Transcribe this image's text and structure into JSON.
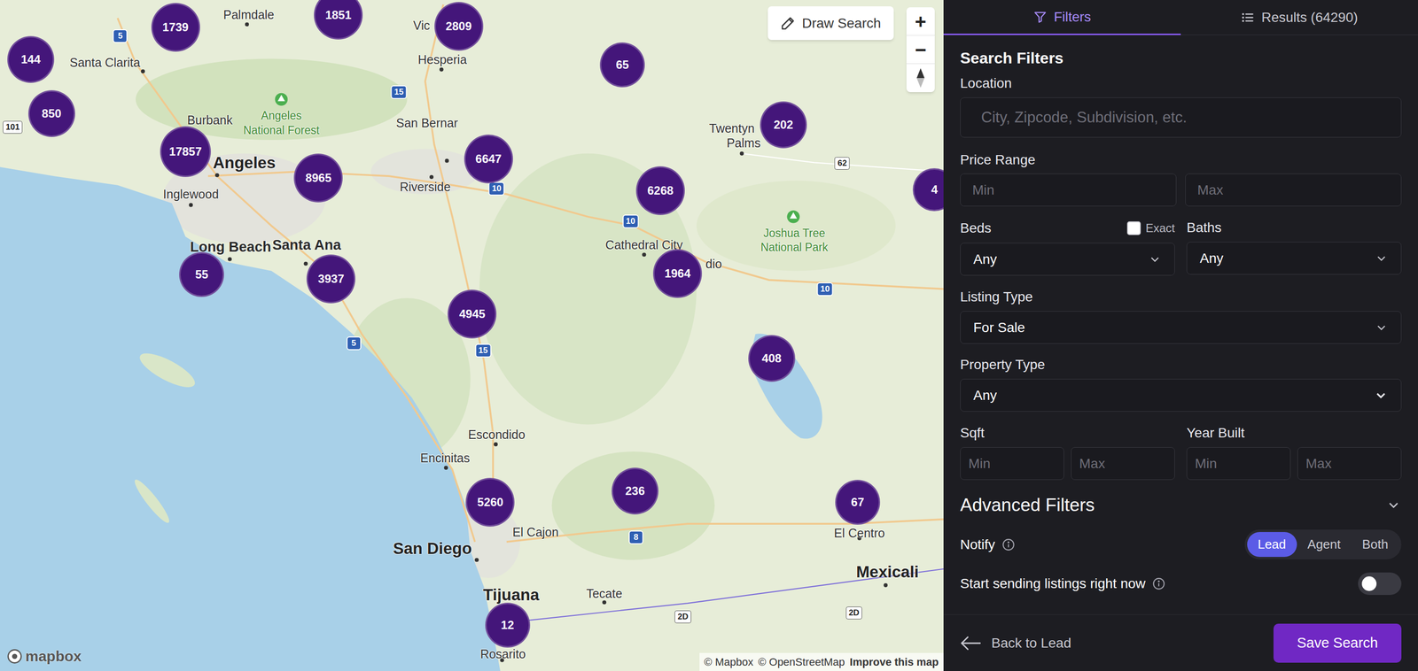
{
  "map": {
    "draw_search": "Draw Search",
    "zoom_in": "+",
    "zoom_out": "−",
    "logo": "mapbox",
    "attribution": {
      "mapbox": "© Mapbox",
      "osm": "© OpenStreetMap",
      "improve": "Improve this map"
    },
    "clusters": [
      {
        "count": "144"
      },
      {
        "count": "850"
      },
      {
        "count": "1739"
      },
      {
        "count": "1851"
      },
      {
        "count": "2809"
      },
      {
        "count": "17857"
      },
      {
        "count": "8965"
      },
      {
        "count": "6647"
      },
      {
        "count": "65"
      },
      {
        "count": "202"
      },
      {
        "count": "6268"
      },
      {
        "count": "4"
      },
      {
        "count": "55"
      },
      {
        "count": "3937"
      },
      {
        "count": "4945"
      },
      {
        "count": "1964"
      },
      {
        "count": "408"
      },
      {
        "count": "5260"
      },
      {
        "count": "236"
      },
      {
        "count": "67"
      },
      {
        "count": "12"
      }
    ],
    "labels": [
      {
        "text": "Palmdale",
        "kind": "city"
      },
      {
        "text": "Santa Clarita",
        "kind": "city"
      },
      {
        "text": "Burbank",
        "kind": "city"
      },
      {
        "text": "Angeles",
        "kind": "major"
      },
      {
        "text": "Inglewood",
        "kind": "city"
      },
      {
        "text": "Long Beach",
        "kind": "town"
      },
      {
        "text": "Santa Ana",
        "kind": "town"
      },
      {
        "text": "San Bernar",
        "kind": "city"
      },
      {
        "text": "Riverside",
        "kind": "city"
      },
      {
        "text": "Hesperia",
        "kind": "city"
      },
      {
        "text": "Vic",
        "kind": "city"
      },
      {
        "text": "Twentyn",
        "kind": "city"
      },
      {
        "text": "Palms",
        "kind": "city"
      },
      {
        "text": "Cathedral City",
        "kind": "city"
      },
      {
        "text": "dio",
        "kind": "city"
      },
      {
        "text": "Angeles",
        "kind": "park"
      },
      {
        "text": "National Forest",
        "kind": "park"
      },
      {
        "text": "Joshua Tree",
        "kind": "park"
      },
      {
        "text": "National Park",
        "kind": "park"
      },
      {
        "text": "Escondido",
        "kind": "city"
      },
      {
        "text": "Encinitas",
        "kind": "city"
      },
      {
        "text": "El Cajon",
        "kind": "city"
      },
      {
        "text": "San Diego",
        "kind": "major"
      },
      {
        "text": "Tijuana",
        "kind": "major"
      },
      {
        "text": "Tecate",
        "kind": "city"
      },
      {
        "text": "Rosarito",
        "kind": "city"
      },
      {
        "text": "El Centro",
        "kind": "city"
      },
      {
        "text": "Mexicali",
        "kind": "major"
      }
    ],
    "shields": [
      {
        "text": "5",
        "kind": "interstate"
      },
      {
        "text": "15",
        "kind": "interstate"
      },
      {
        "text": "10",
        "kind": "interstate"
      },
      {
        "text": "10",
        "kind": "interstate"
      },
      {
        "text": "62",
        "kind": "state"
      },
      {
        "text": "10",
        "kind": "interstate"
      },
      {
        "text": "5",
        "kind": "interstate"
      },
      {
        "text": "15",
        "kind": "interstate"
      },
      {
        "text": "8",
        "kind": "interstate"
      },
      {
        "text": "2D",
        "kind": "state"
      },
      {
        "text": "2D",
        "kind": "state"
      },
      {
        "text": "101",
        "kind": "state"
      }
    ]
  },
  "tabs": [
    {
      "label": "Filters",
      "selected": true
    },
    {
      "label": "Results (64290)",
      "selected": false
    }
  ],
  "filters": {
    "title": "Search Filters",
    "location": {
      "label": "Location",
      "placeholder": "City, Zipcode, Subdivision, etc."
    },
    "price": {
      "label": "Price Range",
      "min_placeholder": "Min",
      "max_placeholder": "Max"
    },
    "beds": {
      "label": "Beds",
      "value": "Any",
      "exact": {
        "label": "Exact",
        "checked": false
      }
    },
    "baths": {
      "label": "Baths",
      "value": "Any"
    },
    "listing_type": {
      "label": "Listing Type",
      "value": "For Sale"
    },
    "property_type": {
      "label": "Property Type",
      "value": "Any"
    },
    "sqft": {
      "label": "Sqft",
      "min_placeholder": "Min",
      "max_placeholder": "Max"
    },
    "year_built": {
      "label": "Year Built",
      "min_placeholder": "Min",
      "max_placeholder": "Max"
    },
    "advanced": {
      "label": "Advanced Filters",
      "expanded": false
    },
    "notify": {
      "label": "Notify",
      "options": [
        {
          "label": "Lead",
          "selected": true
        },
        {
          "label": "Agent",
          "selected": false
        },
        {
          "label": "Both",
          "selected": false
        }
      ]
    },
    "start_sending": {
      "label": "Start sending listings right now",
      "on": false
    }
  },
  "footer": {
    "back": "Back to Lead",
    "save": "Save Search"
  }
}
